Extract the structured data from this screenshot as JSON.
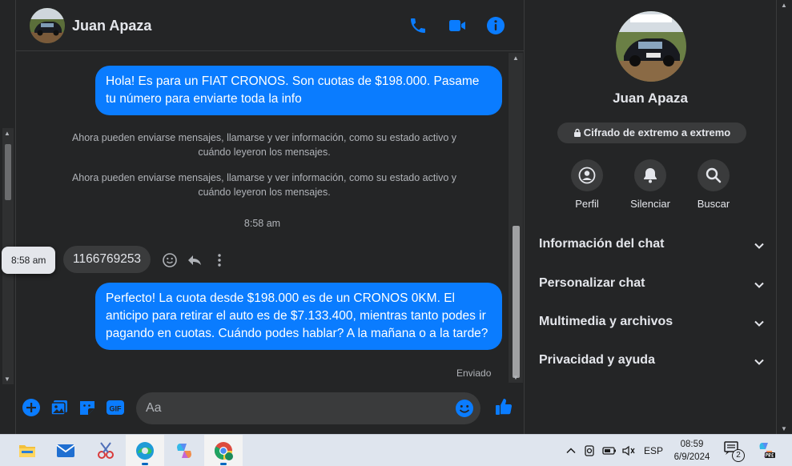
{
  "chat": {
    "contact_name": "Juan Apaza",
    "messages": {
      "out1": "Hola! Es para un FIAT CRONOS. Son cuotas de $198.000. Pasame tu número para enviarte toda la info",
      "sys1": "Ahora pueden enviarse mensajes, llamarse y ver información, como su estado activo y cuándo leyeron los mensajes.",
      "sys2": "Ahora pueden enviarse mensajes, llamarse y ver información, como su estado activo y cuándo leyeron los mensajes.",
      "time_divider": "8:58 am",
      "in1": "1166769253",
      "tooltip_time": "8:58 am",
      "out2": "Perfecto! La cuota desde $198.000 es de un CRONOS 0KM. El anticipo para retirar el auto es de $7.133.400, mientras tanto podes ir pagando en cuotas. Cuándo podes hablar? A la mañana o a la tarde?",
      "status": "Enviado"
    },
    "composer": {
      "placeholder": "Aa"
    }
  },
  "info_panel": {
    "name": "Juan Apaza",
    "encryption_label": "Cifrado de extremo a extremo",
    "actions": [
      {
        "label": "Perfil",
        "icon": "profile-icon"
      },
      {
        "label": "Silenciar",
        "icon": "bell-icon"
      },
      {
        "label": "Buscar",
        "icon": "search-icon"
      }
    ],
    "sections": [
      {
        "label": "Información del chat"
      },
      {
        "label": "Personalizar chat"
      },
      {
        "label": "Multimedia y archivos"
      },
      {
        "label": "Privacidad y ayuda"
      }
    ]
  },
  "taskbar": {
    "language": "ESP",
    "time": "08:59",
    "date": "6/9/2024",
    "notification_count": "2",
    "apps": [
      "file-explorer",
      "mail",
      "snipping-tool",
      "edge",
      "copilot",
      "chrome"
    ]
  },
  "colors": {
    "accent": "#0a7cff",
    "background": "#242526",
    "bubble_in": "#3a3b3c"
  }
}
